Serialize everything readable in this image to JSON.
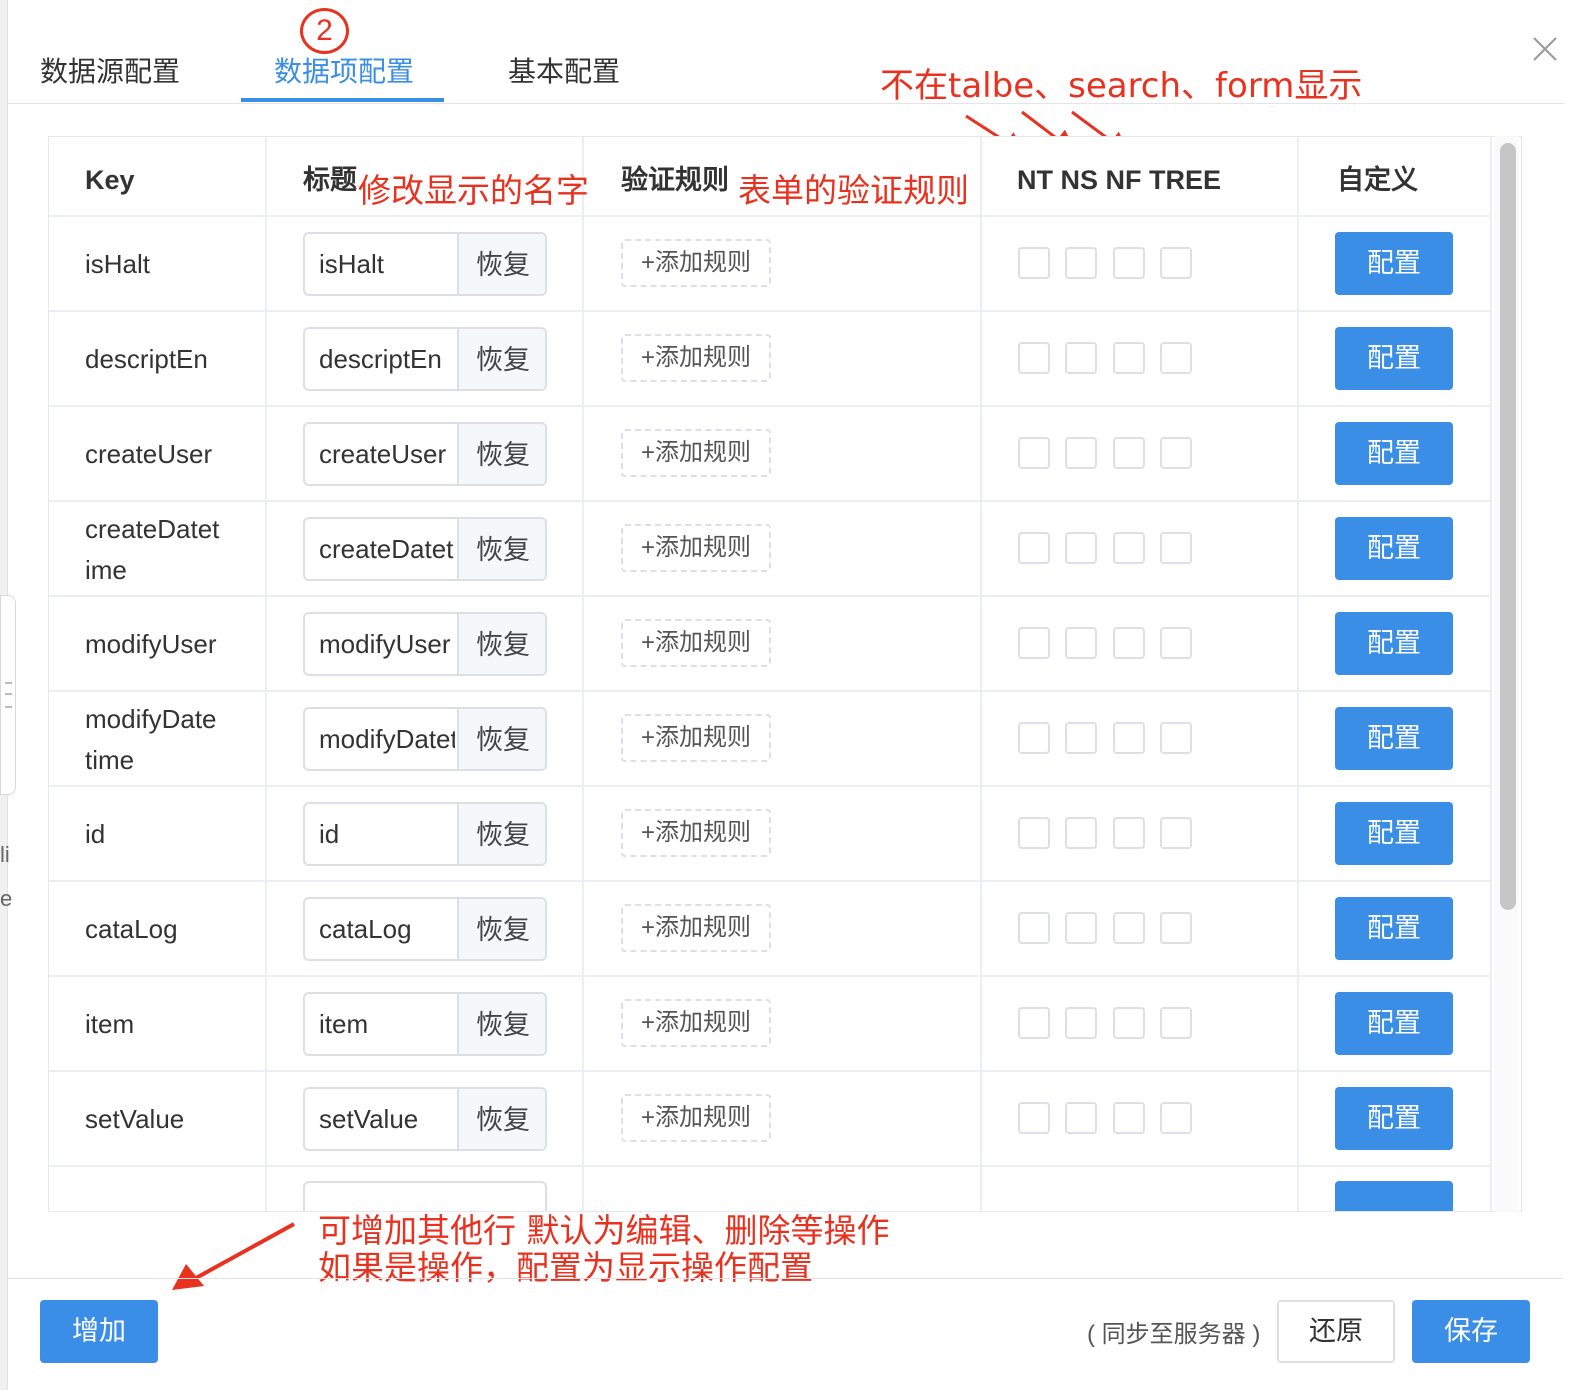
{
  "tabs": [
    {
      "label": "数据源配置",
      "active": false
    },
    {
      "label": "数据项配置",
      "active": true
    },
    {
      "label": "基本配置",
      "active": false
    }
  ],
  "step_badge": "2",
  "annotations": {
    "flags_note": "不在talbe、search、form显示",
    "title_note": "修改显示的名字",
    "rules_note": "表单的验证规则",
    "add_note_line1": "可增加其他行 默认为编辑、删除等操作",
    "add_note_line2": "如果是操作，配置为显示操作配置"
  },
  "table": {
    "headers": {
      "key": "Key",
      "title": "标题",
      "rules": "验证规则",
      "flags": "NT NS NF TREE",
      "custom": "自定义"
    },
    "restore_label": "恢复",
    "add_rule_label": "+添加规则",
    "config_label": "配置",
    "rows": [
      {
        "key": "isHalt",
        "title": "isHalt"
      },
      {
        "key": "descriptEn",
        "title": "descriptEn"
      },
      {
        "key": "createUser",
        "title": "createUser"
      },
      {
        "key": "createDatetime",
        "key_display": "createDatet ime",
        "title": "createDatetime"
      },
      {
        "key": "modifyUser",
        "title": "modifyUser"
      },
      {
        "key": "modifyDatetime",
        "key_display": "modifyDate time",
        "title": "modifyDatetime"
      },
      {
        "key": "id",
        "title": "id"
      },
      {
        "key": "cataLog",
        "title": "cataLog"
      },
      {
        "key": "item",
        "title": "item"
      },
      {
        "key": "setValue",
        "title": "setValue"
      }
    ]
  },
  "footer": {
    "add_label": "增加",
    "sync_text": "( 同步至服务器 )",
    "reset_label": "还原",
    "save_label": "保存"
  },
  "colors": {
    "accent": "#3a8ee6",
    "annotation": "#e8321f",
    "border": "#ebeef5"
  }
}
